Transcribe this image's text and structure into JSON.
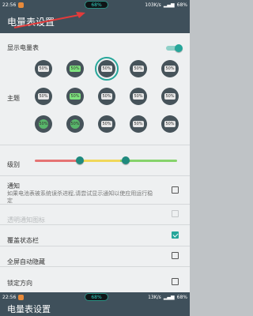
{
  "status": {
    "time": "22:56",
    "speed": "103K/s",
    "battery": "68%",
    "pill": "68%"
  },
  "app": {
    "title": "电量表设置"
  },
  "settings": {
    "show_meter": "显示电量表",
    "theme": "主题",
    "level": "级别",
    "notify": "通知",
    "notify_desc": "如果电池表被系统误杀进程,请尝试显示通知以使应用运行稳定",
    "transparent_notify": "透明通知图标",
    "cover_statusbar": "覆盖状态栏",
    "fullscreen_hide": "全屏自动隐藏",
    "lock_orientation": "锁定方向"
  },
  "themes": [
    {
      "label": "50%"
    },
    {
      "label": "50%"
    },
    {
      "label": "50%"
    },
    {
      "label": "50%"
    },
    {
      "label": "50%"
    },
    {
      "label": "50%"
    },
    {
      "label": "50%"
    },
    {
      "label": "50%"
    },
    {
      "label": "50%"
    },
    {
      "label": "50%"
    },
    {
      "label": "50%"
    },
    {
      "label": "50%"
    },
    {
      "label": "50%"
    },
    {
      "label": "50%"
    },
    {
      "label": "50%"
    }
  ],
  "bottom": {
    "time": "22:56",
    "speed": "13K/s",
    "battery": "68%",
    "pill": "68%",
    "title": "电量表设置"
  },
  "colors": {
    "appbar": "#3f505b",
    "accent": "#26a69a"
  }
}
